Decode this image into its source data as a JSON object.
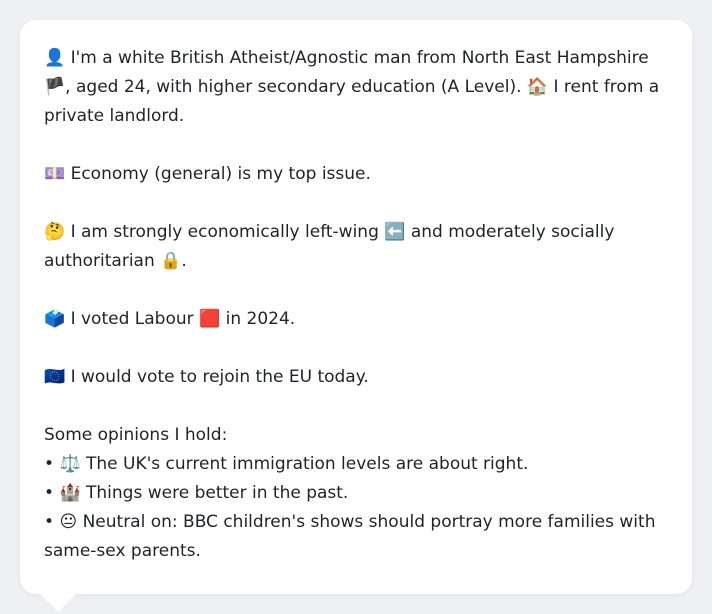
{
  "profile": {
    "intro_prefix_icon": "👤",
    "intro_text_1": "I'm a white British Atheist/Agnostic man from North East Hampshire",
    "flag_icon": "🏴",
    "intro_text_2": ", aged 24, with higher secondary education (A Level).",
    "house_icon": "🏠",
    "intro_text_3": "I rent from a private landlord."
  },
  "issue": {
    "icon": "💷",
    "text": "Economy (general) is my top issue."
  },
  "ideology": {
    "thinking_icon": "🤔",
    "text_1": "I am strongly economically left-wing",
    "left_arrow_icon": "⬅️",
    "text_2": "and moderately socially authoritarian",
    "lock_icon": "🔒",
    "text_3": "."
  },
  "vote": {
    "ballot_icon": "🗳️",
    "text_1": "I voted Labour",
    "party_square_icon": "🟥",
    "text_2": "in 2024."
  },
  "eu": {
    "icon": "🇪🇺",
    "text": "I would vote to rejoin the EU today."
  },
  "opinions": {
    "heading": "Some opinions I hold:",
    "items": [
      {
        "bullet": "•",
        "icon": "⚖️",
        "text": "The UK's current immigration levels are about right."
      },
      {
        "bullet": "•",
        "icon": "🏰",
        "text": "Things were better in the past."
      },
      {
        "bullet": "•",
        "icon": "😐",
        "text": "Neutral on: BBC children's shows should portray more families with same-sex parents."
      }
    ]
  },
  "colors": {
    "background": "#eef0f3",
    "card": "#ffffff",
    "text": "#1f2329"
  }
}
